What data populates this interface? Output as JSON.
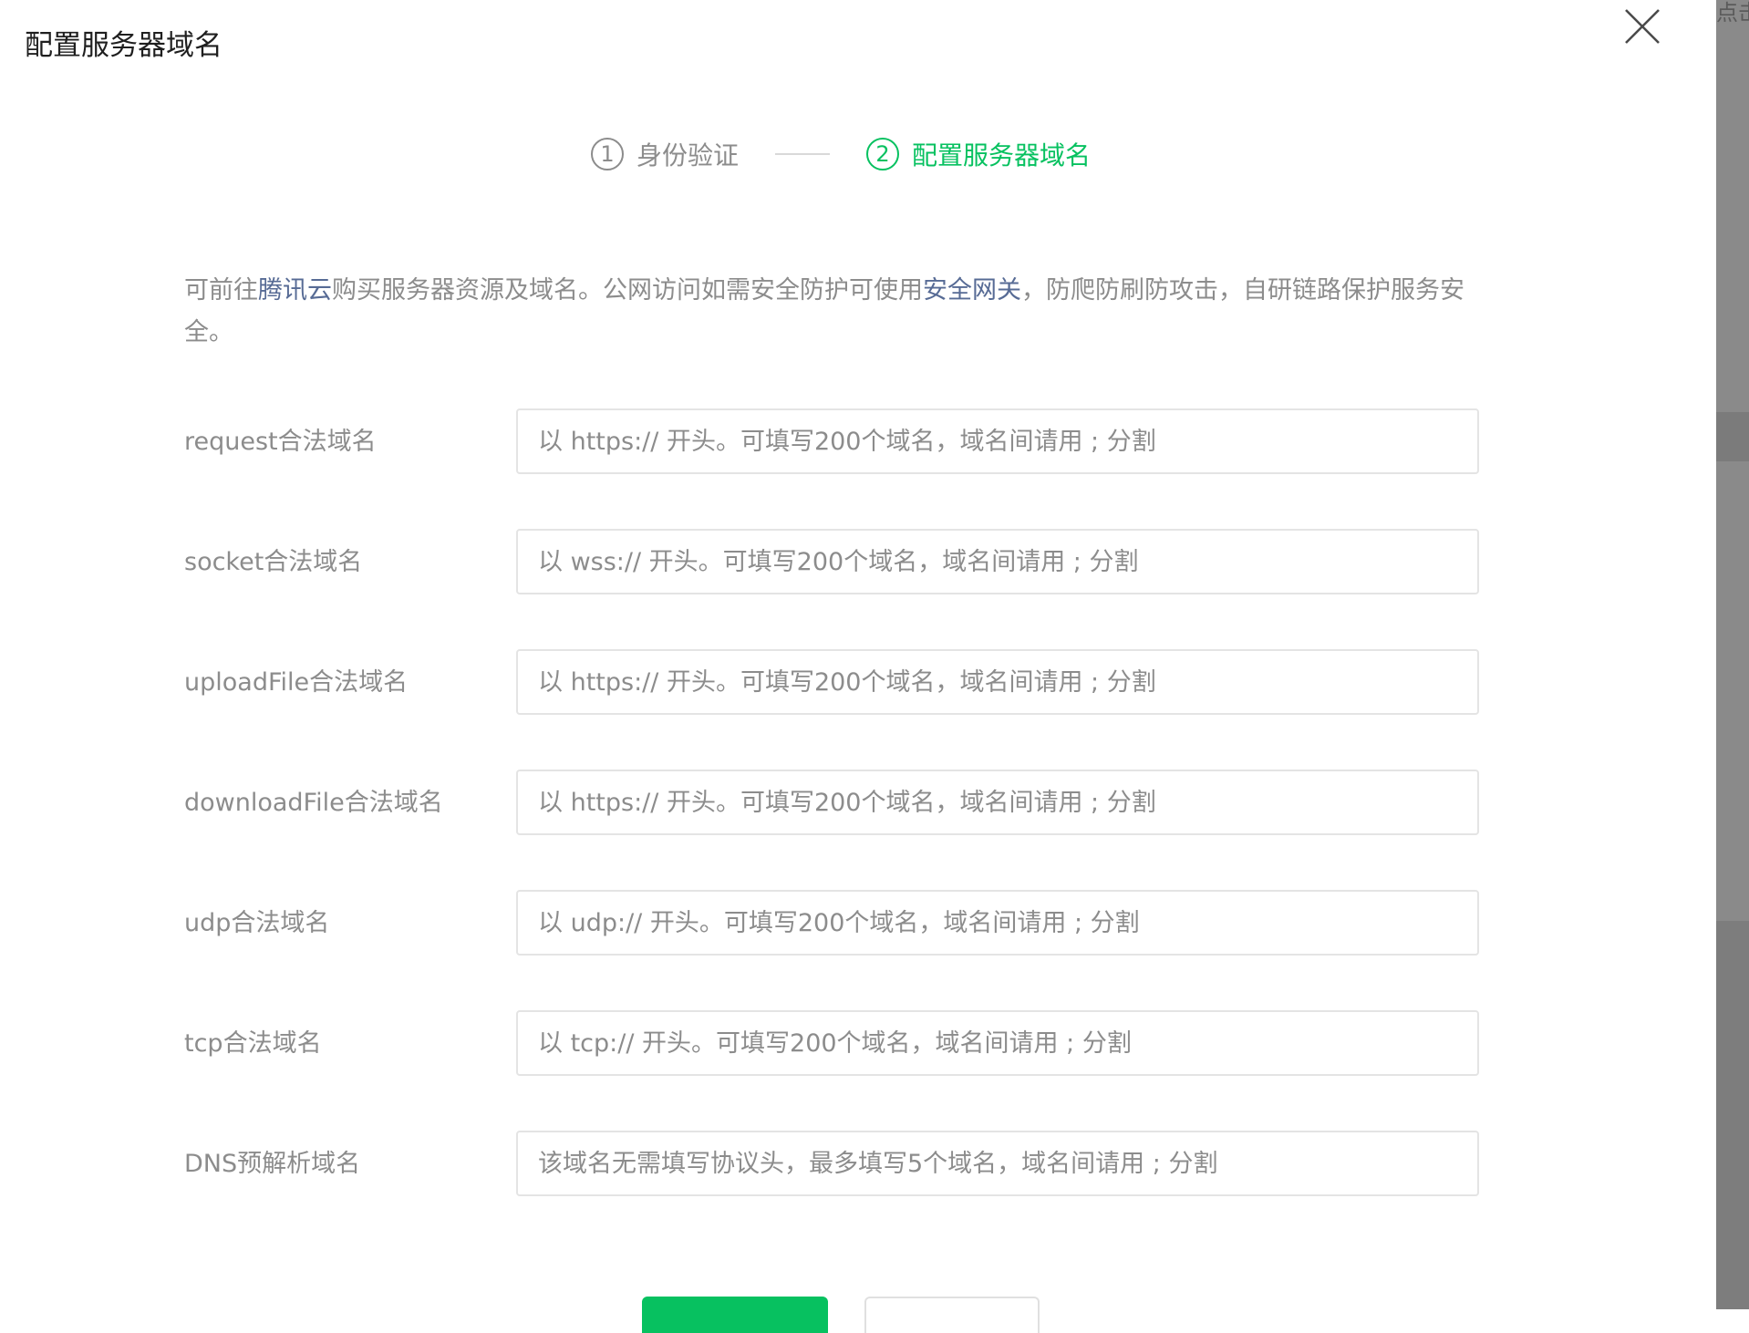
{
  "modal": {
    "title": "配置服务器域名",
    "close_icon": "close-icon"
  },
  "steps": [
    {
      "num": "1",
      "label": "身份验证",
      "state": "done"
    },
    {
      "num": "2",
      "label": "配置服务器域名",
      "state": "active"
    }
  ],
  "notice": {
    "text_1": "可前往",
    "link_1": "腾讯云",
    "text_2": "购买服务器资源及域名。公网访问如需安全防护可使用",
    "link_2": "安全网关",
    "text_3": "，防爬防刷防攻击，自研链路保护服务安全。"
  },
  "fields": [
    {
      "label": "request合法域名",
      "placeholder": "以 https:// 开头。可填写200个域名，域名间请用 ; 分割",
      "value": ""
    },
    {
      "label": "socket合法域名",
      "placeholder": "以 wss:// 开头。可填写200个域名，域名间请用 ; 分割",
      "value": ""
    },
    {
      "label": "uploadFile合法域名",
      "placeholder": "以 https:// 开头。可填写200个域名，域名间请用 ; 分割",
      "value": ""
    },
    {
      "label": "downloadFile合法域名",
      "placeholder": "以 https:// 开头。可填写200个域名，域名间请用 ; 分割",
      "value": ""
    },
    {
      "label": "udp合法域名",
      "placeholder": "以 udp:// 开头。可填写200个域名，域名间请用 ; 分割",
      "value": ""
    },
    {
      "label": "tcp合法域名",
      "placeholder": "以 tcp:// 开头。可填写200个域名，域名间请用 ; 分割",
      "value": ""
    },
    {
      "label": "DNS预解析域名",
      "placeholder": "该域名无需填写协议头，最多填写5个域名，域名间请用 ; 分割",
      "value": ""
    }
  ],
  "background_peek": "点击",
  "colors": {
    "accent": "#07c160",
    "link": "#576b95",
    "muted_text": "#8c8c8c",
    "border": "#e4e4e4"
  }
}
